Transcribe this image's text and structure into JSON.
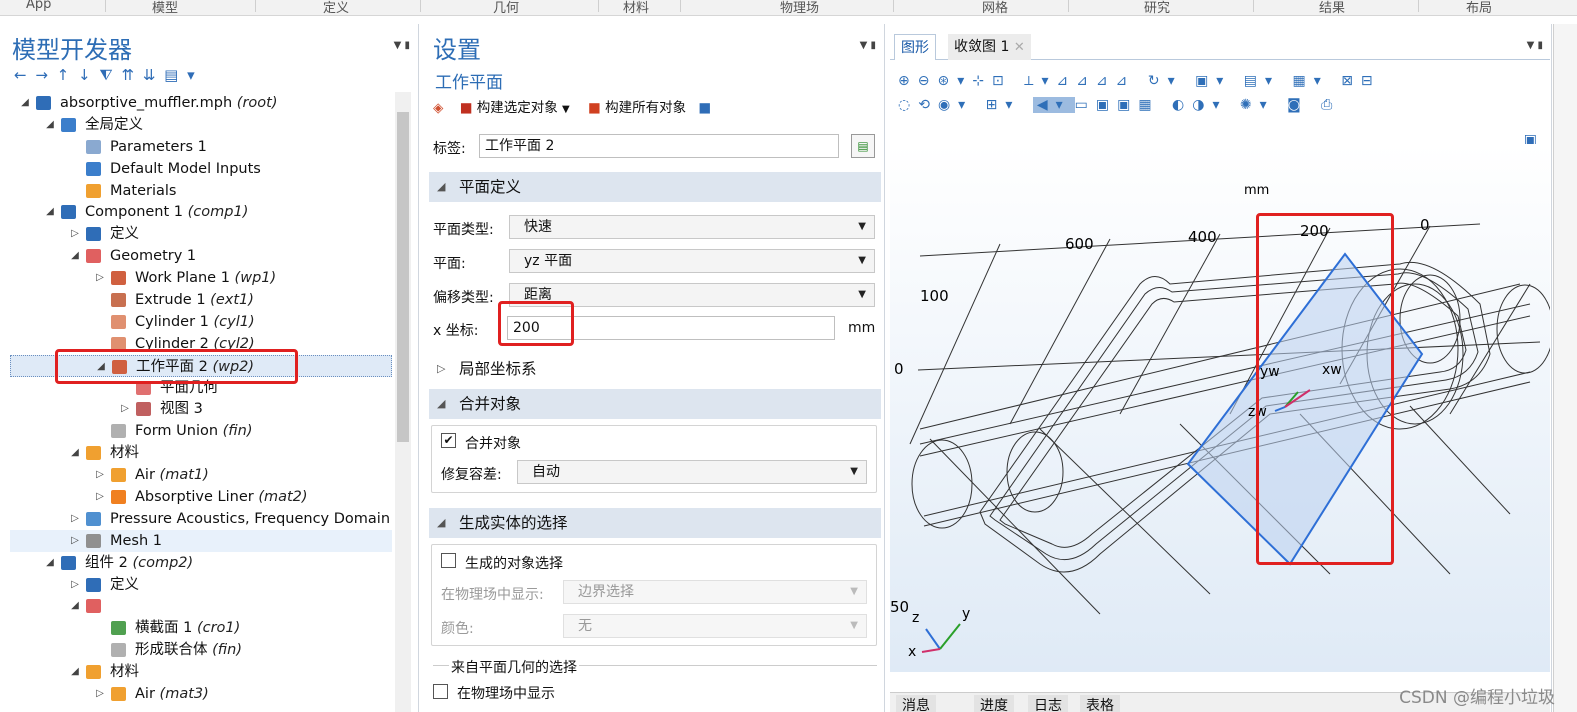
{
  "menubar": [
    "App",
    "模型",
    "定义",
    "几何",
    "材料",
    "物理场",
    "网格",
    "研究",
    "结果",
    "布局"
  ],
  "model_builder": {
    "title": "模型开发器",
    "nav_glyphs": "← → ↑ ↓  ⧨ ⇈ ⇊ ▤ ▾",
    "tree": [
      {
        "label": "absorptive_muffler.mph",
        "tag": "(root)",
        "level": 0,
        "tw": "◢",
        "icon": "mph-file-icon",
        "color": "#2f6db7"
      },
      {
        "label": "全局定义",
        "tag": "",
        "level": 1,
        "tw": "◢",
        "icon": "globe-icon",
        "color": "#3b7ecb"
      },
      {
        "label": "Parameters 1",
        "tag": "",
        "level": 2,
        "tw": "",
        "icon": "parameters-icon",
        "color": "#8aa9d0"
      },
      {
        "label": "Default Model Inputs",
        "tag": "",
        "level": 2,
        "tw": "",
        "icon": "model-inputs-icon",
        "color": "#3b7ecb"
      },
      {
        "label": "Materials",
        "tag": "",
        "level": 2,
        "tw": "",
        "icon": "materials-icon",
        "color": "#f0a030"
      },
      {
        "label": "Component 1",
        "tag": "(comp1)",
        "level": 1,
        "tw": "◢",
        "icon": "component-icon",
        "color": "#2f6db7"
      },
      {
        "label": "定义",
        "tag": "",
        "level": 2,
        "tw": "▷",
        "icon": "definitions-icon",
        "color": "#2f6db7"
      },
      {
        "label": "Geometry 1",
        "tag": "",
        "level": 2,
        "tw": "◢",
        "icon": "geometry-icon",
        "color": "#e06060"
      },
      {
        "label": "Work Plane 1",
        "tag": "(wp1)",
        "level": 3,
        "tw": "▷",
        "icon": "work-plane-icon",
        "color": "#d06040"
      },
      {
        "label": "Extrude 1",
        "tag": "(ext1)",
        "level": 3,
        "tw": "",
        "icon": "extrude-icon",
        "color": "#c87050"
      },
      {
        "label": "Cylinder 1",
        "tag": "(cyl1)",
        "level": 3,
        "tw": "",
        "icon": "cylinder-icon",
        "color": "#e09070"
      },
      {
        "label": "Cylinder 2",
        "tag": "(cyl2)",
        "level": 3,
        "tw": "",
        "icon": "cylinder-icon",
        "color": "#e09070"
      },
      {
        "label": "工作平面 2",
        "tag": "(wp2)",
        "level": 3,
        "tw": "◢",
        "icon": "work-plane-icon",
        "color": "#d06040",
        "selected": true
      },
      {
        "label": "平面几何",
        "tag": "",
        "level": 4,
        "tw": "",
        "icon": "plane-geometry-icon",
        "color": "#e07070"
      },
      {
        "label": "视图 3",
        "tag": "",
        "level": 4,
        "tw": "▷",
        "icon": "view-icon",
        "color": "#c06060"
      },
      {
        "label": "Form Union",
        "tag": "(fin)",
        "level": 3,
        "tw": "",
        "icon": "form-union-icon",
        "color": "#b0b0b0"
      },
      {
        "label": "材料",
        "tag": "",
        "level": 2,
        "tw": "◢",
        "icon": "materials-icon",
        "color": "#f0a030"
      },
      {
        "label": "Air",
        "tag": "(mat1)",
        "level": 3,
        "tw": "▷",
        "icon": "material-icon",
        "color": "#f0a030"
      },
      {
        "label": "Absorptive Liner",
        "tag": "(mat2)",
        "level": 3,
        "tw": "▷",
        "icon": "material-warning-icon",
        "color": "#f08020"
      },
      {
        "label": "Pressure Acoustics, Frequency Domain",
        "tag": "",
        "level": 2,
        "tw": "▷",
        "icon": "acoustics-icon",
        "color": "#5090d0"
      },
      {
        "label": "Mesh 1",
        "tag": "",
        "level": 2,
        "tw": "▷",
        "icon": "mesh-icon",
        "color": "#909090",
        "hover": true
      },
      {
        "label": "组件 2",
        "tag": "(comp2)",
        "level": 1,
        "tw": "◢",
        "icon": "component-2d-icon",
        "color": "#2f6db7"
      },
      {
        "label": "定义",
        "tag": "",
        "level": 2,
        "tw": "▷",
        "icon": "definitions-icon",
        "color": "#2f6db7"
      },
      {
        "label": "",
        "tag": "",
        "level": 2,
        "tw": "◢",
        "icon": "geometry-icon",
        "color": "#e06060"
      },
      {
        "label": "横截面 1",
        "tag": "(cro1)",
        "level": 3,
        "tw": "",
        "icon": "cross-section-icon",
        "color": "#50a050"
      },
      {
        "label": "形成联合体",
        "tag": "(fin)",
        "level": 3,
        "tw": "",
        "icon": "form-union-icon",
        "color": "#b0b0b0"
      },
      {
        "label": "材料",
        "tag": "",
        "level": 2,
        "tw": "◢",
        "icon": "materials-icon",
        "color": "#f0a030"
      },
      {
        "label": "Air",
        "tag": "(mat3)",
        "level": 3,
        "tw": "▷",
        "icon": "material-icon",
        "color": "#f0a030"
      }
    ]
  },
  "settings": {
    "title": "设置",
    "subtitle": "工作平面",
    "build_selected": "构建选定对象",
    "build_all": "构建所有对象",
    "label_caption": "标签:",
    "label_value": "工作平面 2",
    "sec_plane_def": "平面定义",
    "plane_type_caption": "平面类型:",
    "plane_type_value": "快速",
    "plane_caption": "平面:",
    "plane_value": "yz 平面",
    "offset_type_caption": "偏移类型:",
    "offset_type_value": "距离",
    "x_caption": "x 坐标:",
    "x_value": "200",
    "x_unit": "mm",
    "sec_local": "局部坐标系",
    "sec_union": "合并对象",
    "union_checkbox": "合并对象",
    "union_checked": true,
    "repair_caption": "修复容差:",
    "repair_value": "自动",
    "sec_selections": "生成实体的选择",
    "create_sel": "生成的对象选择",
    "show_in_physics_caption": "在物理场中显示:",
    "show_in_physics_value": "边界选择",
    "color_caption": "颜色:",
    "color_value": "无",
    "from_plane_title": "来自平面几何的选择",
    "show_in_physics_cb": "在物理场中显示"
  },
  "graphics": {
    "tab_graphics": "图形",
    "tab_convergence": "收敛图 1",
    "unit": "mm",
    "axis_ticks": [
      "600",
      "400",
      "200",
      "0"
    ],
    "side_ticks": [
      "100",
      "0",
      "50"
    ],
    "plane_axes": [
      "yw",
      "xw",
      "zw"
    ],
    "triad": [
      "z",
      "y",
      "x"
    ],
    "bottom_tabs": [
      "消息",
      "进度",
      "日志",
      "表格"
    ]
  },
  "watermark": "CSDN @编程小垃圾"
}
